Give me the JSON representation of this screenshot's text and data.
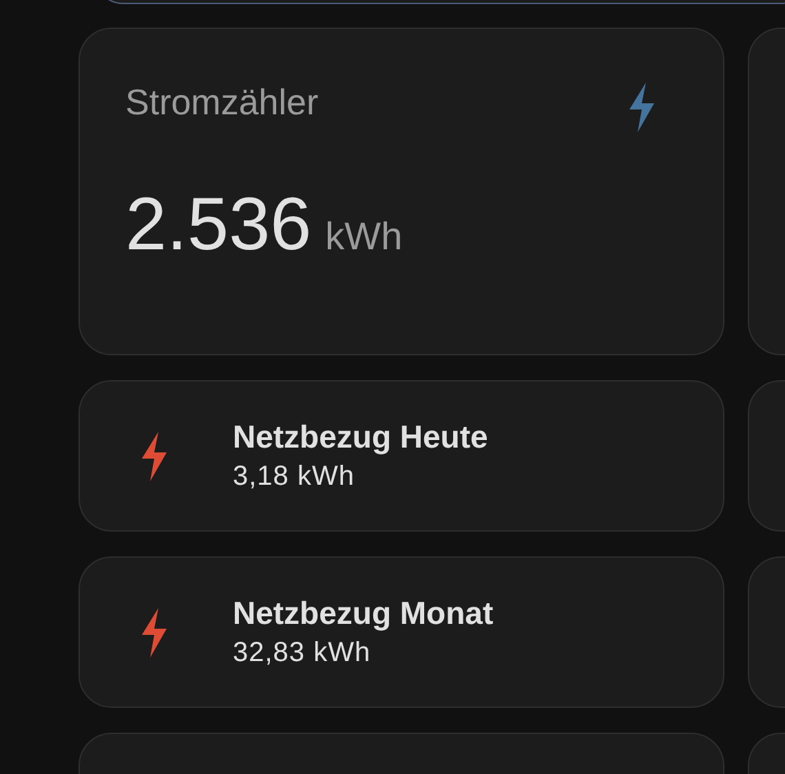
{
  "sensor_card": {
    "title": "Stromzähler",
    "value": "2.536",
    "unit": "kWh"
  },
  "tiles": [
    {
      "name": "Netzbezug Heute",
      "state": "3,18 kWh"
    },
    {
      "name": "Netzbezug Monat",
      "state": "32,83 kWh"
    }
  ]
}
